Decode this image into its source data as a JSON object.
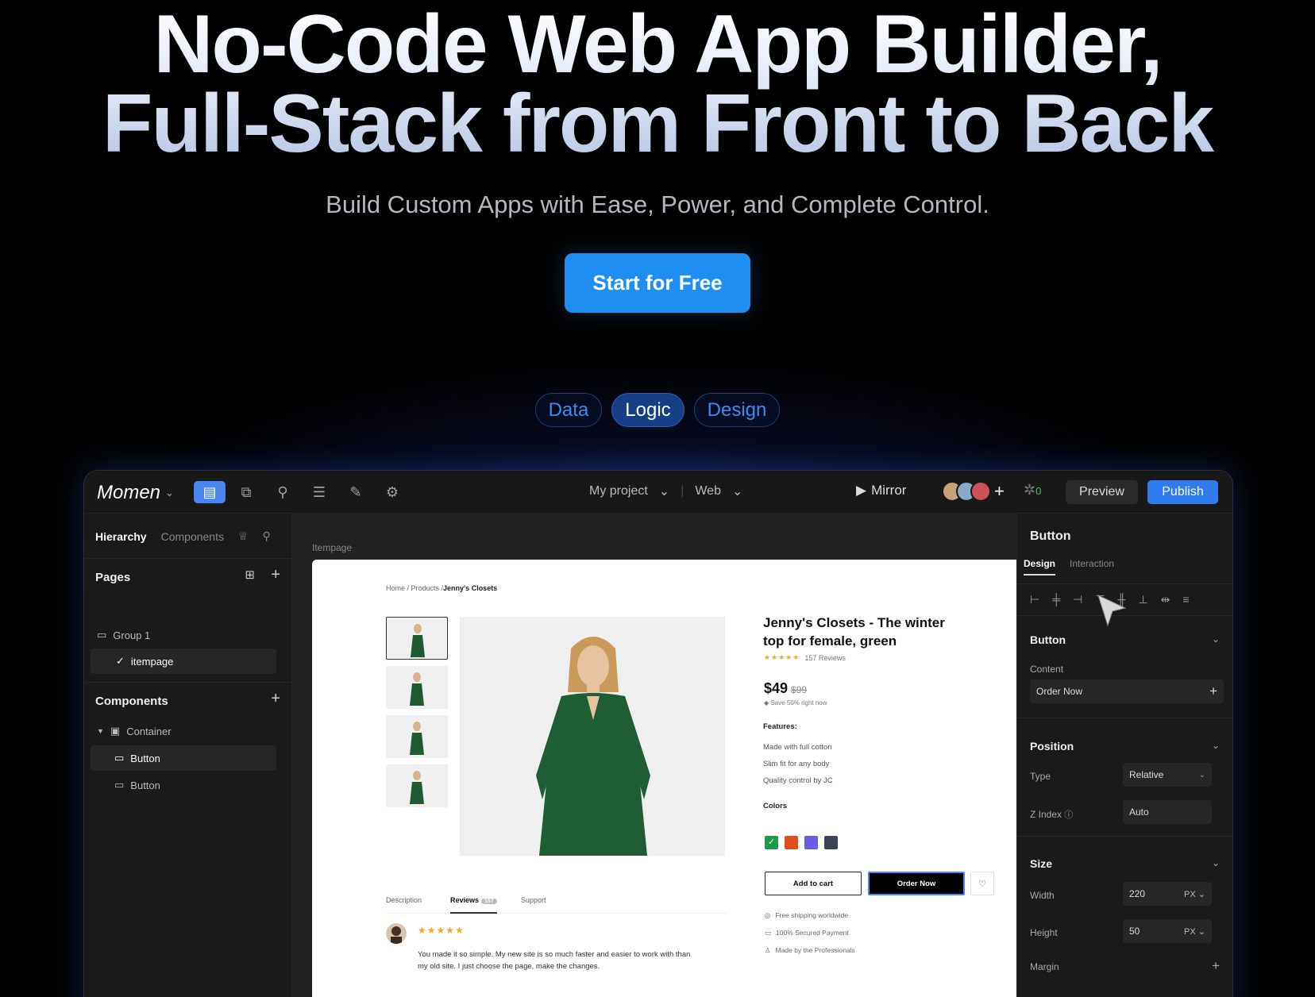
{
  "hero": {
    "title_line1": "No-Code Web App Builder,",
    "title_line2": "Full-Stack from Front to Back",
    "subtitle": "Build Custom Apps with Ease, Power, and Complete Control.",
    "cta": "Start for Free"
  },
  "pills": [
    {
      "label": "Data",
      "active": false
    },
    {
      "label": "Logic",
      "active": true
    },
    {
      "label": "Design",
      "active": false
    }
  ],
  "app": {
    "logo": "Momen",
    "project": "My project",
    "platform": "Web",
    "mirror": "Mirror",
    "notification_count": "0",
    "preview": "Preview",
    "publish": "Publish",
    "left": {
      "tabs": [
        "Hierarchy",
        "Components"
      ],
      "pages_title": "Pages",
      "group": "Group 1",
      "page": "itempage",
      "components_title": "Components",
      "tree": [
        "Container",
        "Button",
        "Button"
      ]
    },
    "canvas": {
      "label": "Itempage",
      "breadcrumb_prefix": "Home / Products /",
      "breadcrumb_current": "Jenny's Closets",
      "product_title": "Jenny's Closets - The winter top for female, green",
      "stars": "★★★★★",
      "reviews_count": "157 Reviews",
      "price": "$49",
      "old_price": "$99",
      "save": "Save 50% right now",
      "features_title": "Features:",
      "features": [
        "Made with full cotton",
        "Slim fit for any body",
        "Quality control by JC"
      ],
      "colors_title": "Colors",
      "colors": [
        "#1a9a4a",
        "#e0501c",
        "#6b5ce8",
        "#3b4556"
      ],
      "add_to_cart": "Add to cart",
      "order_now": "Order Now",
      "shipping": [
        "Free shipping worldwide",
        "100% Secured Payment",
        "Made by the Professionals"
      ],
      "tabs": [
        "Description",
        "Reviews",
        "Support"
      ],
      "reviews_badge": "157",
      "review_stars": "★★★★★",
      "review_text": "You made it so simple. My new site is so much faster and easier to work with than my old site. I just choose the page, make the changes."
    },
    "right": {
      "title": "Button",
      "tabs": [
        "Design",
        "Interaction"
      ],
      "button_section": "Button",
      "content_label": "Content",
      "content_value": "Order Now",
      "position_section": "Position",
      "type_label": "Type",
      "type_value": "Relative",
      "zindex_label": "Z Index",
      "zindex_value": "Auto",
      "size_section": "Size",
      "width_label": "Width",
      "width_value": "220",
      "height_label": "Height",
      "height_value": "50",
      "unit": "PX",
      "margin_label": "Margin"
    }
  },
  "colors": {
    "accent": "#1e8ff0",
    "publish": "#2f7bf0",
    "pill_active": "#163f86"
  }
}
